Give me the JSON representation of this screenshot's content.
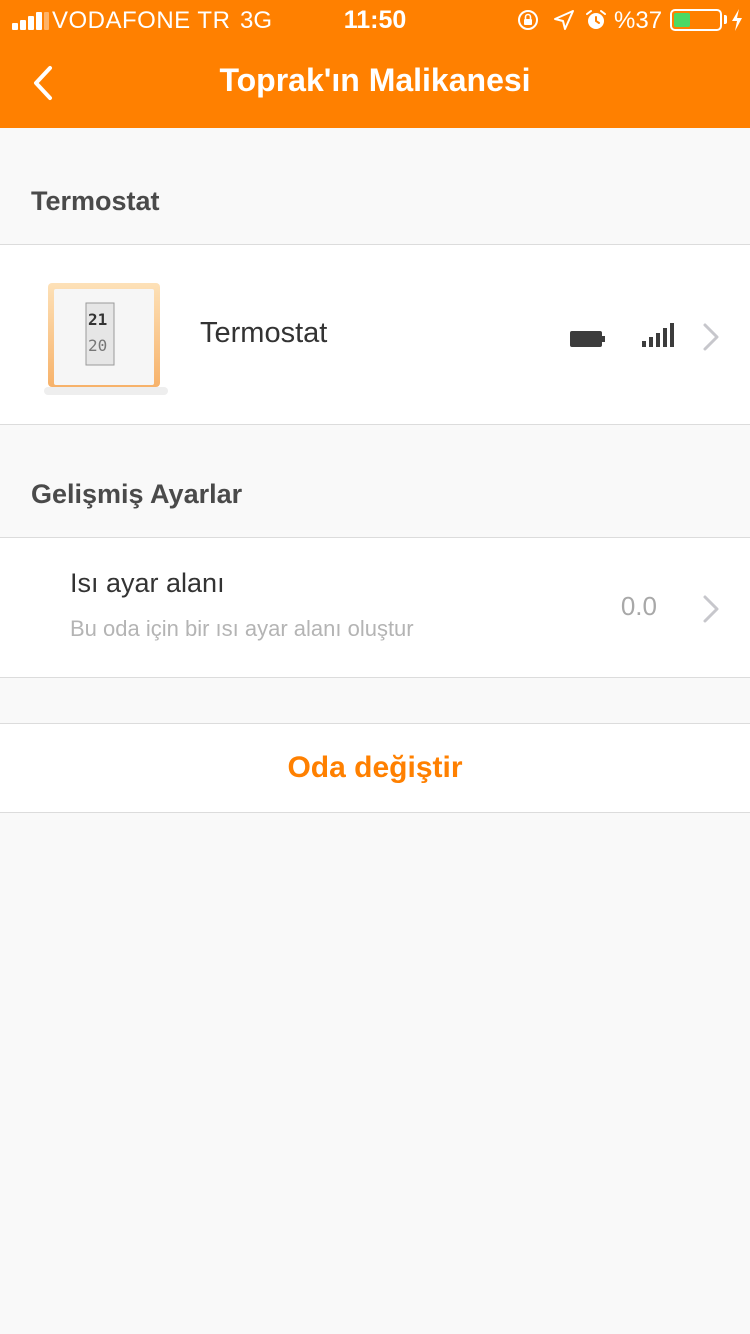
{
  "status_bar": {
    "carrier": "VODAFONE TR",
    "network": "3G",
    "time": "11:50",
    "battery_percent": "%37",
    "battery_level": 0.37,
    "battery_color": "#4cd964"
  },
  "nav": {
    "title": "Toprak'ın Malikanesi",
    "back_icon": "chevron-left-icon"
  },
  "thermostat_section": {
    "header": "Termostat",
    "device": {
      "name": "Termostat",
      "display_top": "21",
      "display_bottom": "20",
      "battery_icon": "battery-icon",
      "signal_icon": "signal-strength-icon"
    }
  },
  "advanced_section": {
    "header": "Gelişmiş Ayarlar",
    "heating_zone": {
      "title": "Isı ayar alanı",
      "subtitle": "Bu oda için bir ısı ayar alanı oluştur",
      "value": "0.0"
    }
  },
  "change_room": {
    "label": "Oda değiştir"
  },
  "colors": {
    "accent": "#ff8000",
    "background": "#f9f9f9"
  }
}
